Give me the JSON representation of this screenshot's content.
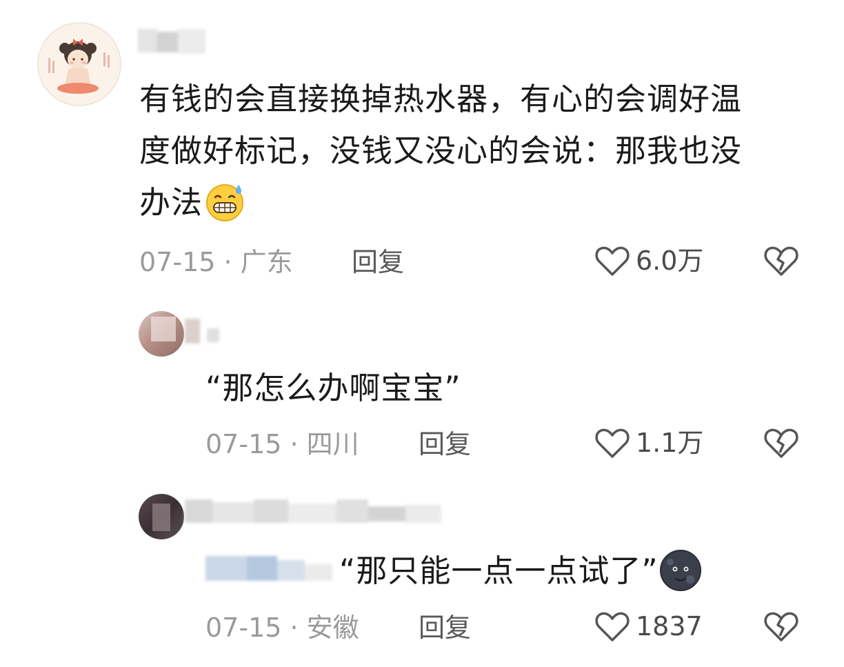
{
  "comments": [
    {
      "text_line1": "有钱的会直接换掉热水器，有心的会调好温",
      "text_line2": "度做好标记，没钱又没心的会说：那我也没",
      "text_line3": "办法",
      "emoji": "grimacing-sweat-emoji",
      "date_location": "07-15 · 广东",
      "reply_label": "回复",
      "likes": "6.0万",
      "replies": [
        {
          "text": "“那怎么办啊宝宝”",
          "date_location": "07-15 · 四川",
          "reply_label": "回复",
          "likes": "1.1万"
        },
        {
          "text": "“那只能一点一点试了”",
          "emoji": "new-moon-face-emoji",
          "date_location": "07-15 · 安徽",
          "reply_label": "回复",
          "likes": "1837"
        }
      ]
    }
  ],
  "icons": {
    "like": "heart-outline-icon",
    "dislike": "broken-heart-icon"
  },
  "colors": {
    "text": "#1a1a1a",
    "meta": "#9a9a9a",
    "reply_button": "#595959",
    "icon": "#555555"
  }
}
